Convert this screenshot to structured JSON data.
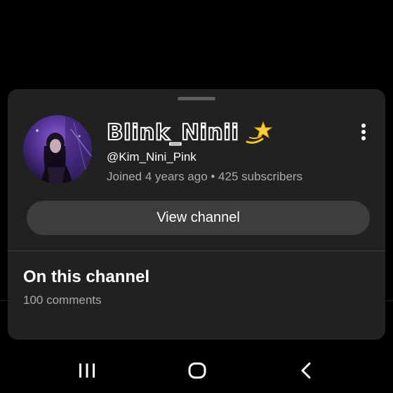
{
  "channel_sheet": {
    "name": "Blink_Ninii",
    "name_icon": "dizzy-star-icon",
    "handle": "@Kim_Nini_Pink",
    "meta": "Joined 4 years ago • 425 subscribers",
    "more_icon": "more-vertical-icon",
    "view_channel_label": "View channel"
  },
  "on_this_channel": {
    "title": "On this channel",
    "comments": "100 comments"
  },
  "navbar": {
    "recents_icon": "recents-icon",
    "home_icon": "home-icon",
    "back_icon": "back-icon"
  },
  "colors": {
    "background": "#000000",
    "sheet": "#212121",
    "button": "#3d3d3d",
    "secondary_text": "#aaaaaa"
  }
}
